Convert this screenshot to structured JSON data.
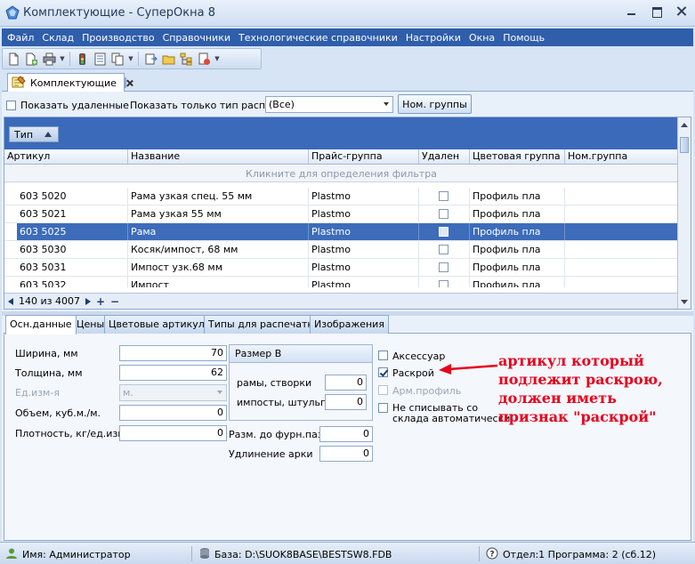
{
  "window": {
    "title": "Комплектующие - СуперОкна 8"
  },
  "menu": [
    "Файл",
    "Склад",
    "Производство",
    "Справочники",
    "Технологические справочники",
    "Настройки",
    "Окна",
    "Помощь"
  ],
  "doc_tab": {
    "label": "Комплектующие"
  },
  "filter": {
    "show_deleted": "Показать удаленные",
    "print_type_label": "Показать только тип распеч.",
    "print_type_value": "(Все)",
    "nom_groups_button": "Ном. группы"
  },
  "grid": {
    "group_by": "Тип",
    "columns": [
      "Артикул",
      "Название",
      "Прайс-группа",
      "Удален",
      "Цветовая группа",
      "Ном.группа"
    ],
    "filter_hint": "Кликните для определения фильтра",
    "rows": [
      {
        "article": "603 5020",
        "name": "Рама узкая спец. 55 мм",
        "price_group": "Plastmo",
        "color_group": "Профиль пла"
      },
      {
        "article": "603 5021",
        "name": "Рама узкая 55 мм",
        "price_group": "Plastmo",
        "color_group": "Профиль пла"
      },
      {
        "article": "603 5025",
        "name": "Рама",
        "price_group": "Plastmo",
        "color_group": "Профиль пла"
      },
      {
        "article": "603 5030",
        "name": "Косяк/импост, 68 мм",
        "price_group": "Plastmo",
        "color_group": "Профиль пла"
      },
      {
        "article": "603 5031",
        "name": "Импост узк.68 мм",
        "price_group": "Plastmo",
        "color_group": "Профиль пла"
      },
      {
        "article": "603 5032",
        "name": "Импост",
        "price_group": "Plastmo",
        "color_group": "Профиль пла"
      }
    ],
    "selected_row": 2,
    "record_counter": "140 из 4007",
    "nav_add": "+",
    "nav_remove": "−"
  },
  "detail_tabs": [
    "Осн.данные",
    "Цены",
    "Цветовые артикулы",
    "Типы для распечатки",
    "Изображения"
  ],
  "detail": {
    "width_label": "Ширина, мм",
    "width_value": "70",
    "thickness_label": "Толщина, мм",
    "thickness_value": "62",
    "unit_label": "Ед.изм-я",
    "unit_value": "м.",
    "volume_label": "Объем, куб.м./м.",
    "volume_value": "0",
    "density_label": "Плотность, кг/ед.изм.",
    "density_value": "0",
    "size_group_title": "Размер В",
    "frames_label": "рамы, створки",
    "frames_value": "0",
    "imposts_label": "импосты, штульпы",
    "imposts_value": "0",
    "hw_size_label": "Разм. до фурн.паза",
    "hw_size_value": "0",
    "arch_label": "Удлинение арки",
    "arch_value": "0",
    "accessory_label": "Аксессуар",
    "cutting_label": "Раскрой",
    "arm_profile_label": "Арм.профиль",
    "no_writeoff_label": "Не списывать со склада автоматически"
  },
  "annotation": "артикул который подлежит раскрою, должен иметь признак \"раскрой\"",
  "status": {
    "user": "Имя: Администратор",
    "database": "База: D:\\SUOK8BASE\\BESTSW8.FDB",
    "program": "Отдел:1 Программа: 2 (сб.12)"
  },
  "colors": {
    "menu_bg": "#2f5eaa",
    "selection": "#3c6cba",
    "annotation": "#e8001c"
  }
}
